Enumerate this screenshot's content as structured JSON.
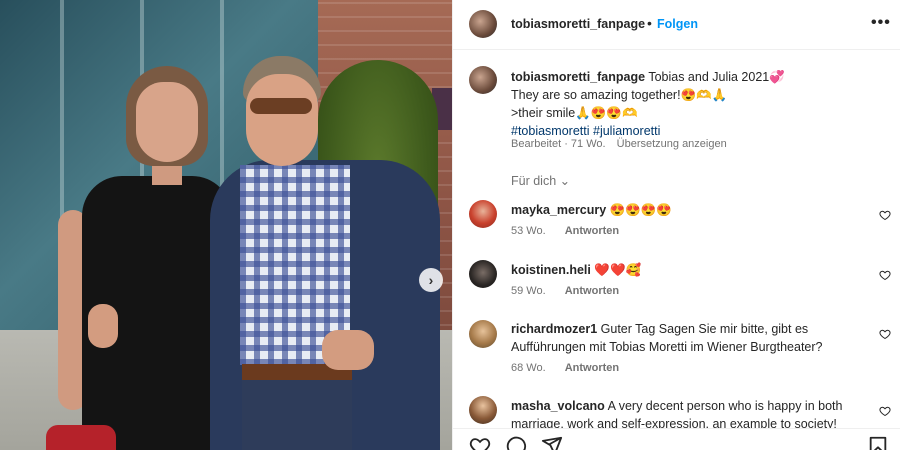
{
  "header": {
    "username": "tobiasmoretti_fanpage",
    "dot": "•",
    "follow_label": "Folgen",
    "more_label": "•••"
  },
  "caption": {
    "username": "tobiasmoretti_fanpage",
    "line1": "Tobias and Julia 2021💞",
    "line2": "They are so amazing together!😍🫶🙏",
    "line3": ">their smile🙏😍😍🫶",
    "hashtag1": "#tobiasmoretti",
    "hashtag2": "#juliamoretti",
    "edited": "Bearbeitet · 71 Wo.",
    "translate": "Übersetzung anzeigen"
  },
  "for_you": {
    "label": "Für dich",
    "chevron": "⌄"
  },
  "comments": [
    {
      "username": "mayka_mercury",
      "text": "😍😍😍😍",
      "time": "53 Wo.",
      "reply": "Antworten"
    },
    {
      "username": "koistinen.heli",
      "text": "❤️❤️🥰",
      "time": "59 Wo.",
      "reply": "Antworten"
    },
    {
      "username": "richardmozer1",
      "text": "Guter Tag Sagen Sie mir bitte, gibt es Aufführungen mit Tobias Moretti im Wiener Burgtheater?",
      "time": "68 Wo.",
      "reply": "Antworten"
    },
    {
      "username": "masha_volcano",
      "text": "A very decent person who is happy in both marriage, work and self-expression, an example to society!",
      "time": "",
      "reply": ""
    }
  ],
  "carousel": {
    "next_label": "›"
  },
  "icons": {
    "like": "heart-icon",
    "comment": "comment-icon",
    "share": "share-icon",
    "save": "bookmark-icon"
  },
  "colors": {
    "accent": "#0095f6",
    "hashtag": "#00376b",
    "muted": "#737373"
  }
}
